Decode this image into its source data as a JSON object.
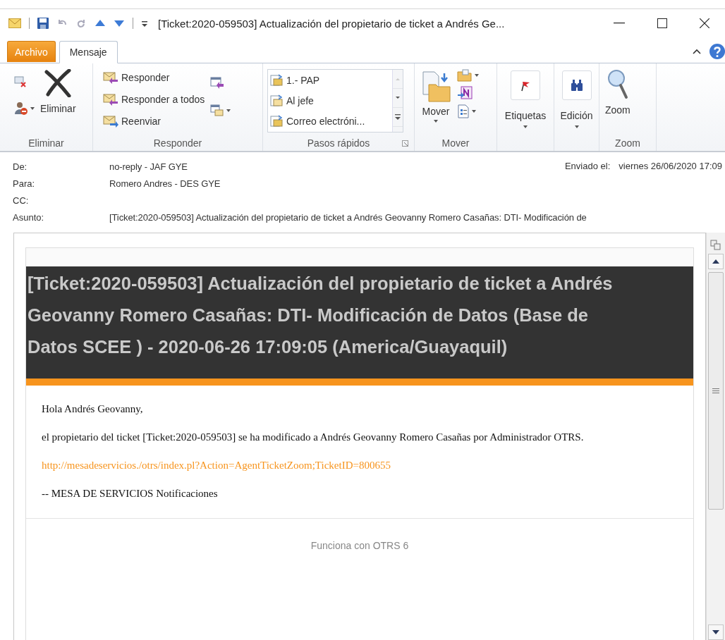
{
  "title_bar": {
    "title": "[Ticket:2020-059503] Actualización del propietario de ticket a Andrés Ge..."
  },
  "tabs": [
    {
      "label": "Archivo",
      "kind": "backstage",
      "selected": false
    },
    {
      "label": "Mensaje",
      "kind": "ribbon",
      "selected": true
    }
  ],
  "ribbon": {
    "groups": [
      {
        "kind": "delete",
        "label": "Eliminar",
        "buttons": [
          {
            "label": "Eliminar"
          }
        ]
      },
      {
        "kind": "respond",
        "label": "Responder",
        "buttons": [
          {
            "label": "Responder"
          },
          {
            "label": "Responder a todos"
          },
          {
            "label": "Reenviar"
          }
        ]
      },
      {
        "kind": "quicksteps",
        "label": "Pasos rápidos",
        "buttons": [
          {
            "label": "1.- PAP"
          },
          {
            "label": "Al jefe"
          },
          {
            "label": "Correo electróni..."
          }
        ]
      },
      {
        "kind": "move",
        "label": "Mover",
        "buttons": [
          {
            "label": "Mover"
          }
        ]
      },
      {
        "kind": "tags",
        "buttons": [
          {
            "label": "Etiquetas"
          }
        ]
      },
      {
        "kind": "edit",
        "buttons": [
          {
            "label": "Edición"
          }
        ]
      },
      {
        "kind": "zoom",
        "label": "Zoom",
        "buttons": [
          {
            "label": "Zoom"
          }
        ]
      }
    ]
  },
  "header": {
    "fields": [
      {
        "label": "De:",
        "value": "no-reply - JAF GYE"
      },
      {
        "label": "Para:",
        "value": "Romero Andres - DES GYE"
      },
      {
        "label": "CC:"
      },
      {
        "label": "Asunto:",
        "value": "[Ticket:2020-059503] Actualización del propietario de ticket a Andrés Geovanny Romero Casañas: DTI- Modificación de"
      }
    ],
    "sent": {
      "label": "Enviado el:",
      "value": "viernes 26/06/2020 17:09"
    }
  },
  "message": {
    "heading": "[Ticket:2020-059503] Actualización del propietario de ticket a Andrés Geovanny Romero Casañas: DTI- Modificación de Datos (Base de Datos  SCEE ) - 2020-06-26 17:09:05 (America/Guayaquil)",
    "greeting": "Hola Andrés Geovanny,",
    "paragraph": "el propietario del ticket [Ticket:2020-059503] se ha modificado a Andrés Geovanny Romero Casañas por Administrador OTRS.",
    "link": "http://mesadeservicios./otrs/index.pl?Action=AgentTicketZoom;TicketID=800655",
    "signature": "-- MESA DE SERVICIOS Notificaciones",
    "footer": "Funciona con OTRS 6"
  }
}
